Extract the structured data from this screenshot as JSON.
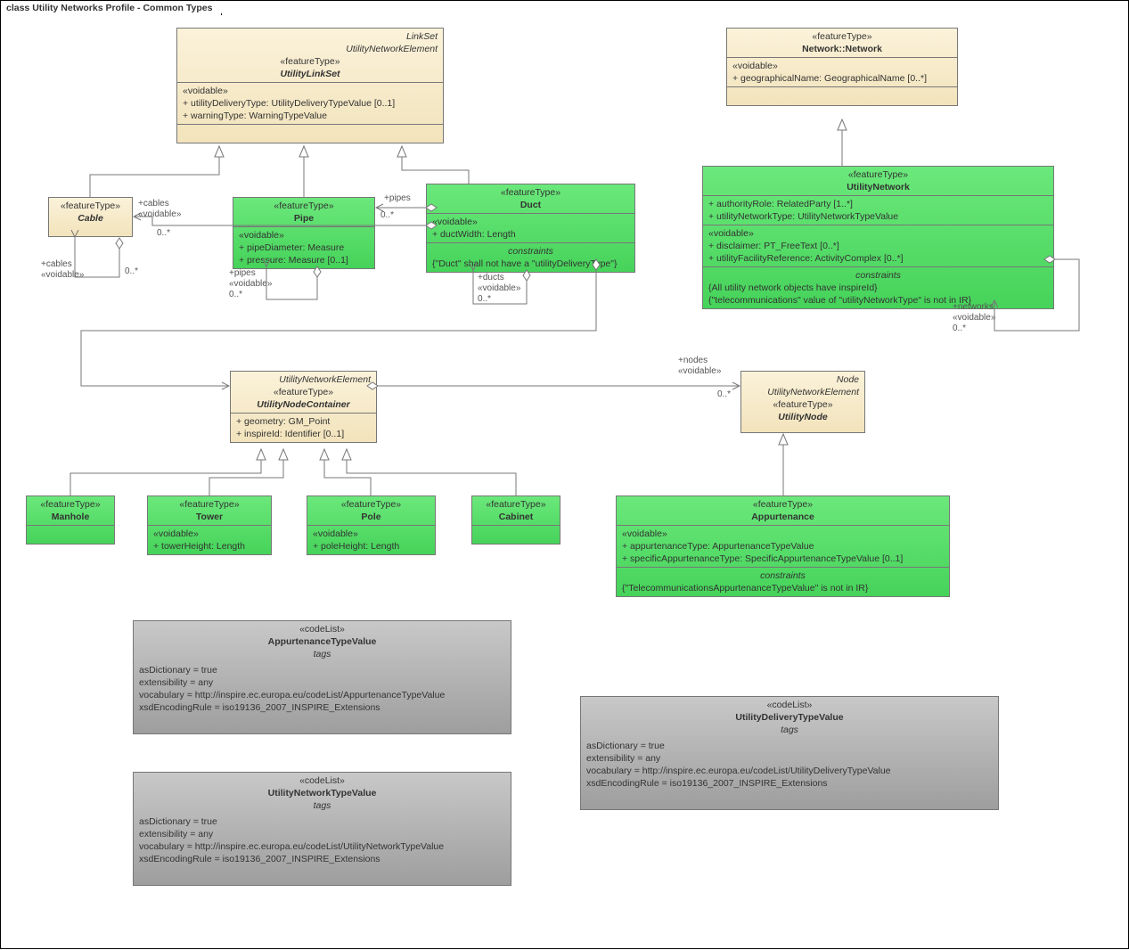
{
  "title": "class Utility Networks Profile -  Common Types",
  "uls": {
    "superclasses": "LinkSet\nUtilityNetworkElement",
    "stereo": "«featureType»",
    "name": "UtilityLinkSet",
    "voidable": "«voidable»",
    "a1": "+   utilityDeliveryType: UtilityDeliveryTypeValue [0..1]",
    "a2": "+   warningType: WarningTypeValue"
  },
  "cable": {
    "stereo": "«featureType»",
    "name": "Cable"
  },
  "pipe": {
    "stereo": "«featureType»",
    "name": "Pipe",
    "voidable": "«voidable»",
    "a1": "+   pipeDiameter: Measure",
    "a2": "+   pressure: Measure [0..1]"
  },
  "duct": {
    "stereo": "«featureType»",
    "name": "Duct",
    "voidable": "«voidable»",
    "a1": "+   ductWidth: Length",
    "chdr": "constraints",
    "c1": "{\"Duct\" shall not have a \"utilityDeliveryType\"}"
  },
  "nn": {
    "stereo": "«featureType»",
    "name": "Network::Network",
    "voidable": "«voidable»",
    "a1": "+   geographicalName: GeographicalName [0..*]"
  },
  "un": {
    "stereo": "«featureType»",
    "name": "UtilityNetwork",
    "a1": "+   authorityRole: RelatedParty [1..*]",
    "a2": "+   utilityNetworkType: UtilityNetworkTypeValue",
    "voidable": "«voidable»",
    "a3": "+   disclaimer: PT_FreeText [0..*]",
    "a4": "+   utilityFacilityReference: ActivityComplex [0..*]",
    "chdr": "constraints",
    "c1": "{All utility network objects have inspireId}",
    "c2": "{\"telecommunications\" value of \"utilityNetworkType\" is not in IR}"
  },
  "unc": {
    "superclasses": "UtilityNetworkElement",
    "stereo": "«featureType»",
    "name": "UtilityNodeContainer",
    "a1": "+   geometry: GM_Point",
    "a2": "+   inspireId: Identifier [0..1]"
  },
  "unode": {
    "superclasses": "Node\nUtilityNetworkElement",
    "stereo": "«featureType»",
    "name": "UtilityNode"
  },
  "manhole": {
    "stereo": "«featureType»",
    "name": "Manhole"
  },
  "tower": {
    "stereo": "«featureType»",
    "name": "Tower",
    "voidable": "«voidable»",
    "a1": "+   towerHeight: Length"
  },
  "pole": {
    "stereo": "«featureType»",
    "name": "Pole",
    "voidable": "«voidable»",
    "a1": "+   poleHeight: Length"
  },
  "cabinet": {
    "stereo": "«featureType»",
    "name": "Cabinet"
  },
  "app": {
    "stereo": "«featureType»",
    "name": "Appurtenance",
    "voidable": "«voidable»",
    "a1": "+   appurtenanceType: AppurtenanceTypeValue",
    "a2": "+   specificAppurtenanceType: SpecificAppurtenanceTypeValue [0..1]",
    "chdr": "constraints",
    "c1": "{\"TelecommunicationsAppurtenanceTypeValue\" is not in IR}"
  },
  "cl1": {
    "stereo": "«codeList»",
    "name": "AppurtenanceTypeValue",
    "tags": "tags",
    "t1": "asDictionary = true",
    "t2": "extensibility = any",
    "t3": "vocabulary = http://inspire.ec.europa.eu/codeList/AppurtenanceTypeValue",
    "t4": "xsdEncodingRule = iso19136_2007_INSPIRE_Extensions"
  },
  "cl2": {
    "stereo": "«codeList»",
    "name": "UtilityNetworkTypeValue",
    "tags": "tags",
    "t1": "asDictionary = true",
    "t2": "extensibility = any",
    "t3": "vocabulary = http://inspire.ec.europa.eu/codeList/UtilityNetworkTypeValue",
    "t4": "xsdEncodingRule = iso19136_2007_INSPIRE_Extensions"
  },
  "cl3": {
    "stereo": "«codeList»",
    "name": "UtilityDeliveryTypeValue",
    "tags": "tags",
    "t1": "asDictionary = true",
    "t2": "extensibility = any",
    "t3": "vocabulary = http://inspire.ec.europa.eu/codeList/UtilityDeliveryTypeValue",
    "t4": "xsdEncodingRule = iso19136_2007_INSPIRE_Extensions"
  },
  "lbl": {
    "cables": "+cables",
    "voidable": "«voidable»",
    "zm": "0..*",
    "pipes": "+pipes",
    "ducts": "+ducts",
    "nodes": "+nodes",
    "networks": "+networks"
  }
}
